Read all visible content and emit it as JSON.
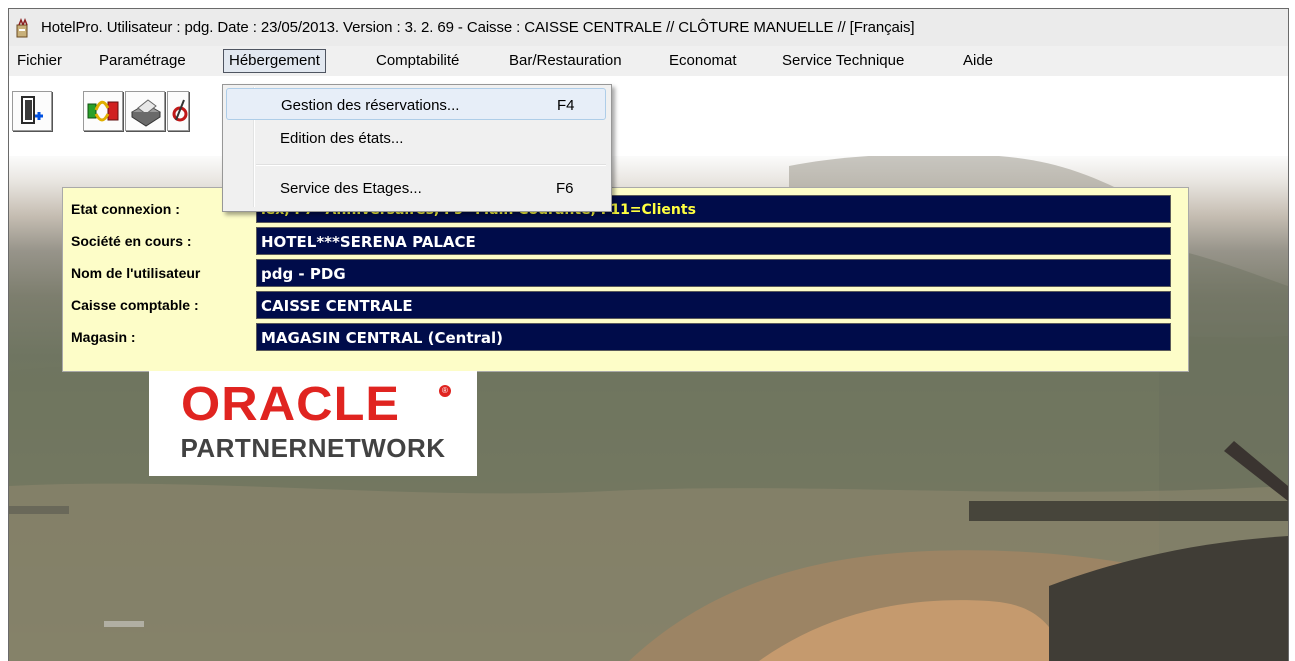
{
  "window": {
    "title": "HotelPro. Utilisateur : pdg.   Date : 23/05/2013.   Version :  3. 2. 69 - Caisse : CAISSE CENTRALE // CLÔTURE MANUELLE // [Français]"
  },
  "menubar": {
    "items": [
      {
        "label": "Fichier"
      },
      {
        "label": "Paramétrage"
      },
      {
        "label": "Hébergement"
      },
      {
        "label": "Comptabilité"
      },
      {
        "label": "Bar/Restauration"
      },
      {
        "label": "Economat"
      },
      {
        "label": "Service Technique"
      },
      {
        "label": "Aide"
      }
    ],
    "active_index": 2
  },
  "dropdown": {
    "items": [
      {
        "label": "Gestion des réservations...",
        "shortcut": "F4"
      },
      {
        "label": "Edition des états...",
        "shortcut": ""
      },
      {
        "label": "Service des Etages...",
        "shortcut": "F6"
      }
    ]
  },
  "toolbar": {
    "buttons": [
      {
        "icon": "exit-door-icon"
      },
      {
        "icon": "transfer-icon"
      },
      {
        "icon": "printer-icon"
      },
      {
        "icon": "tool-icon"
      }
    ]
  },
  "info_panel": {
    "rows": [
      {
        "label": "Etat connexion :",
        "value": "lex, F7=Anniversaires, F9=Main Courante, F11=Clients"
      },
      {
        "label": "Société en cours :",
        "value": "HOTEL***SERENA PALACE"
      },
      {
        "label": "Nom de l'utilisateur",
        "value": "pdg - PDG"
      },
      {
        "label": "Caisse comptable :",
        "value": "CAISSE CENTRALE"
      },
      {
        "label": "Magasin :",
        "value": "MAGASIN CENTRAL (Central)"
      }
    ]
  },
  "logo": {
    "brand": "ORACLE",
    "registered": "®",
    "subtitle": "PARTNERNETWORK"
  },
  "colors": {
    "info_panel_bg": "#fdfdc8",
    "info_value_bg": "#000c4a",
    "info_value_text": "#ffffff",
    "shortcut_hint_text": "#ffff40",
    "oracle_red": "#e02420"
  }
}
